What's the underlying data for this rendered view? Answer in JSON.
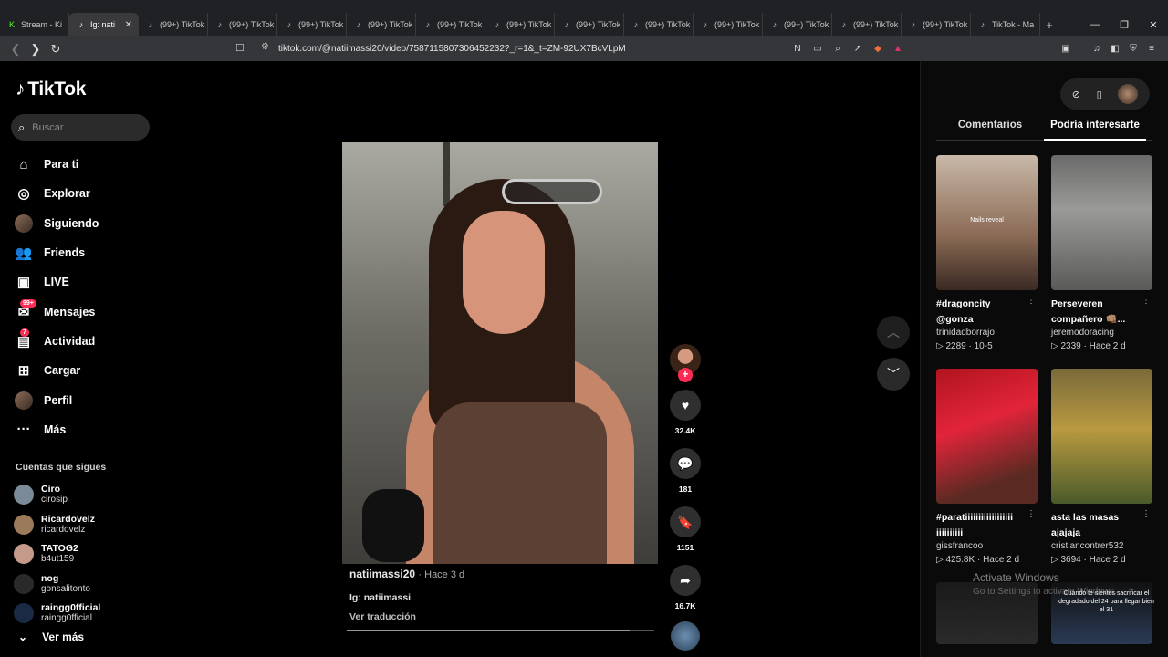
{
  "browser": {
    "tabs": [
      {
        "label": "Stream - Ki",
        "favicon": "kick-icon",
        "active": false
      },
      {
        "label": "Ig: nati",
        "favicon": "tiktok-icon",
        "active": true
      },
      {
        "label": "(99+) TikTok",
        "favicon": "tiktok-icon",
        "active": false
      },
      {
        "label": "(99+) TikTok",
        "favicon": "tiktok-icon",
        "active": false
      },
      {
        "label": "(99+) TikTok",
        "favicon": "tiktok-icon",
        "active": false
      },
      {
        "label": "(99+) TikTok",
        "favicon": "tiktok-icon",
        "active": false
      },
      {
        "label": "(99+) TikTok",
        "favicon": "tiktok-icon",
        "active": false
      },
      {
        "label": "(99+) TikTok",
        "favicon": "tiktok-icon",
        "active": false
      },
      {
        "label": "(99+) TikTok",
        "favicon": "tiktok-icon",
        "active": false
      },
      {
        "label": "(99+) TikTok",
        "favicon": "tiktok-icon",
        "active": false
      },
      {
        "label": "(99+) TikTok",
        "favicon": "tiktok-icon",
        "active": false
      },
      {
        "label": "(99+) TikTok",
        "favicon": "tiktok-icon",
        "active": false
      },
      {
        "label": "(99+) TikTok",
        "favicon": "tiktok-icon",
        "active": false
      },
      {
        "label": "(99+) TikTok",
        "favicon": "tiktok-icon",
        "active": false
      },
      {
        "label": "TikTok - Ma",
        "favicon": "tiktok-icon",
        "active": false
      }
    ],
    "url": "tiktok.com/@natiimassi20/video/7587115807306452232?_r=1&_t=ZM-92UX7BcVLpM"
  },
  "sidebar": {
    "logo": "TikTok",
    "search_placeholder": "Buscar",
    "menu": [
      {
        "label": "Para ti",
        "icon": "home-icon"
      },
      {
        "label": "Explorar",
        "icon": "compass-icon"
      },
      {
        "label": "Siguiendo",
        "icon": "following-avatar"
      },
      {
        "label": "Friends",
        "icon": "friends-icon"
      },
      {
        "label": "LIVE",
        "icon": "live-icon"
      },
      {
        "label": "Mensajes",
        "icon": "messages-icon",
        "badge": "99+"
      },
      {
        "label": "Actividad",
        "icon": "activity-icon",
        "badge": "7"
      },
      {
        "label": "Cargar",
        "icon": "upload-icon"
      },
      {
        "label": "Perfil",
        "icon": "profile-avatar"
      },
      {
        "label": "Más",
        "icon": "more-icon"
      }
    ],
    "following_title": "Cuentas que sigues",
    "following": [
      {
        "name": "Ciro",
        "user": "cirosip"
      },
      {
        "name": "Ricardovelz",
        "user": "ricardovelz"
      },
      {
        "name": "TATOG2",
        "user": "b4ut159"
      },
      {
        "name": "nog",
        "user": "gonsalitonto"
      },
      {
        "name": "raingg0fficial",
        "user": "raingg0fficial"
      }
    ],
    "see_more": "Ver más"
  },
  "video": {
    "author": "natiimassi20",
    "time": "Hace 3 d",
    "caption": "Ig: natiimassi",
    "translate": "Ver traducción",
    "likes": "32.4K",
    "comments": "181",
    "saves": "1151",
    "shares": "16.7K",
    "progress": 0.92
  },
  "right": {
    "tab_comments": "Comentarios",
    "tab_interest": "Podría interesarte",
    "cards": [
      {
        "title": "#dragoncity @gonza",
        "user": "trinidadborrajo",
        "views": "2289",
        "date": "10-5",
        "overlay": "Nails reveal"
      },
      {
        "title": "Perseveren compañero 👊🏽...",
        "user": "jeremodoracing",
        "views": "2339",
        "date": "Hace 2 d",
        "overlay": ""
      },
      {
        "title": "#paratiiiiiiiiiiiiiiiiii iiiiiiiiii",
        "user": "gissfrancoo",
        "views": "425.8K",
        "date": "Hace 2 d",
        "overlay": ""
      },
      {
        "title": "asta las masas ajajaja",
        "user": "cristiancontrer532",
        "views": "3694",
        "date": "Hace 2 d",
        "overlay": ""
      }
    ],
    "next_overlay": "Cuando te sientes sacrificar el degradado del 24 para llegar bien el 31"
  },
  "watermark": {
    "line1": "Activate Windows",
    "line2": "Go to Settings to activate Windows."
  }
}
